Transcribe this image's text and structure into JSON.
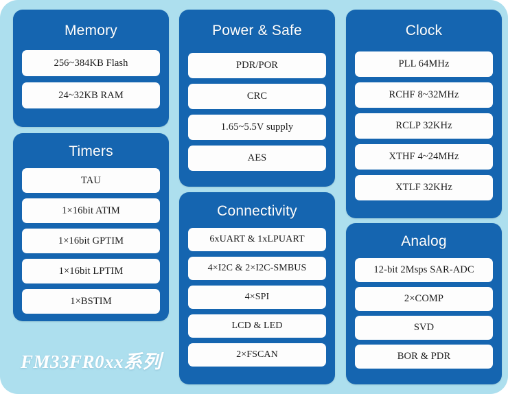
{
  "theme": {
    "background": "#addfee",
    "card_background": "#1565b0",
    "item_background": "#fdfdfd",
    "title_color": "#ffffff",
    "item_text_color": "#1a1a1a"
  },
  "series_label": "FM33FR0xx系列",
  "columns": [
    {
      "cards": [
        {
          "id": "memory",
          "title": "Memory",
          "items": [
            "256~384KB Flash",
            "24~32KB RAM"
          ]
        },
        {
          "id": "timers",
          "title": "Timers",
          "items": [
            "TAU",
            "1×16bit ATIM",
            "1×16bit GPTIM",
            "1×16bit LPTIM",
            "1×BSTIM"
          ]
        }
      ]
    },
    {
      "cards": [
        {
          "id": "power",
          "title": "Power & Safe",
          "items": [
            "PDR/POR",
            "CRC",
            "1.65~5.5V supply",
            "AES"
          ]
        },
        {
          "id": "connectivity",
          "title": "Connectivity",
          "items": [
            "6xUART & 1xLPUART",
            "4×I2C & 2×I2C-SMBUS",
            "4×SPI",
            "LCD & LED",
            "2×FSCAN"
          ]
        }
      ]
    },
    {
      "cards": [
        {
          "id": "clock",
          "title": "Clock",
          "items": [
            "PLL 64MHz",
            "RCHF 8~32MHz",
            "RCLP 32KHz",
            "XTHF 4~24MHz",
            "XTLF 32KHz"
          ]
        },
        {
          "id": "analog",
          "title": "Analog",
          "items": [
            "12-bit 2Msps SAR-ADC",
            "2×COMP",
            "SVD",
            "BOR & PDR"
          ]
        }
      ]
    }
  ]
}
